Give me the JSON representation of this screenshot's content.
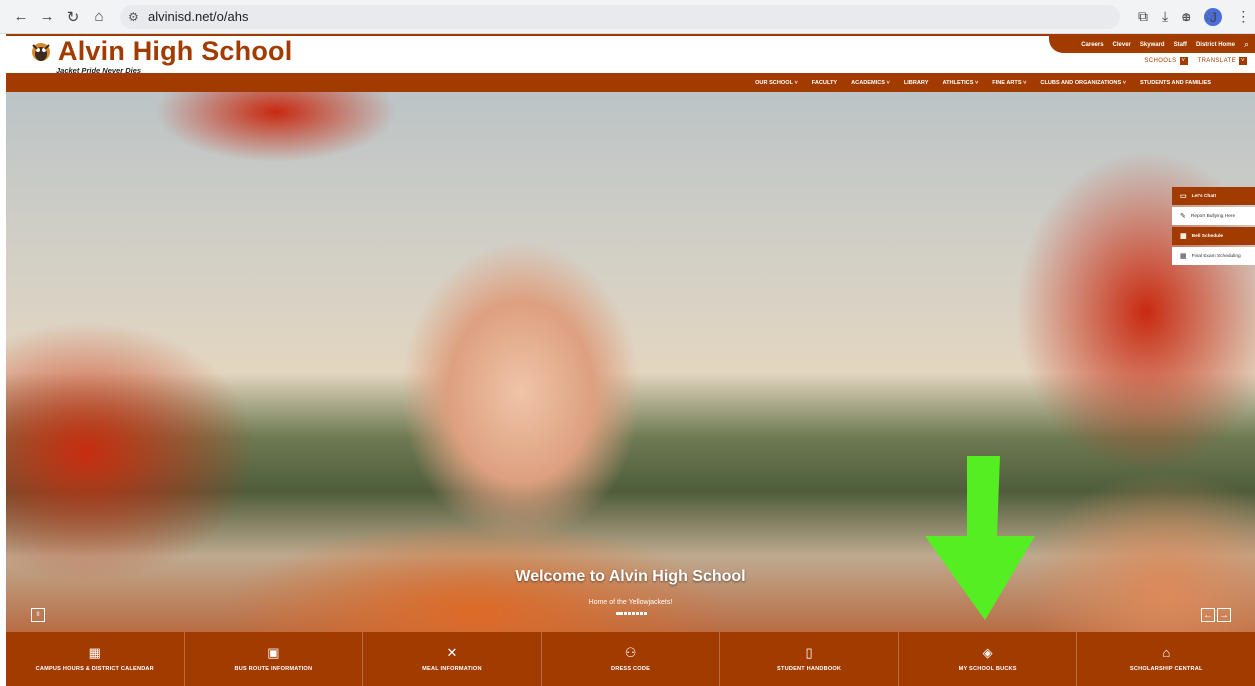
{
  "browser": {
    "back": "←",
    "forward": "→",
    "reload": "↻",
    "home": "⌂",
    "url": "alvinisd.net/o/ahs",
    "avatar_initial": "J"
  },
  "header": {
    "title": "Alvin High School",
    "tagline": "Jacket Pride Never Dies",
    "utility_links": [
      "Careers",
      "Clever",
      "Skyward",
      "Staff",
      "District Home"
    ],
    "schools_label": "SCHOOLS",
    "translate_label": "TRANSLATE"
  },
  "nav": {
    "items": [
      {
        "label": "OUR SCHOOL ˅"
      },
      {
        "label": "FACULTY"
      },
      {
        "label": "ACADEMICS ˅"
      },
      {
        "label": "LIBRARY"
      },
      {
        "label": "ATHLETICS ˅"
      },
      {
        "label": "FINE ARTS ˅"
      },
      {
        "label": "CLUBS AND ORGANIZATIONS ˅"
      },
      {
        "label": "STUDENTS AND FAMILIES"
      }
    ]
  },
  "hero": {
    "title": "Welcome to Alvin High School",
    "subtitle": "Home of the Yellowjackets!",
    "pause": "II",
    "prev": "←",
    "next": "→"
  },
  "quick_links": [
    {
      "label": "Let's Chat!",
      "icon": "chat-icon"
    },
    {
      "label": "Report Bullying Here",
      "icon": "report-icon"
    },
    {
      "label": "Bell Schedule",
      "icon": "calendar-icon"
    },
    {
      "label": "Final Exam Scheduling",
      "icon": "calendar-icon"
    }
  ],
  "bottom_links": [
    {
      "label": "CAMPUS HOURS & DISTRICT CALENDAR",
      "icon": "calendar-icon"
    },
    {
      "label": "BUS ROUTE INFORMATION",
      "icon": "bus-icon"
    },
    {
      "label": "MEAL INFORMATION",
      "icon": "utensils-icon"
    },
    {
      "label": "DRESS CODE",
      "icon": "people-icon"
    },
    {
      "label": "STUDENT HANDBOOK",
      "icon": "book-icon"
    },
    {
      "label": "MY SCHOOL BUCKS",
      "icon": "money-icon"
    },
    {
      "label": "SCHOLARSHIP CENTRAL",
      "icon": "graduation-cap-icon"
    }
  ],
  "colors": {
    "brand": "#a23b00",
    "annotation_arrow": "#55ee22"
  }
}
